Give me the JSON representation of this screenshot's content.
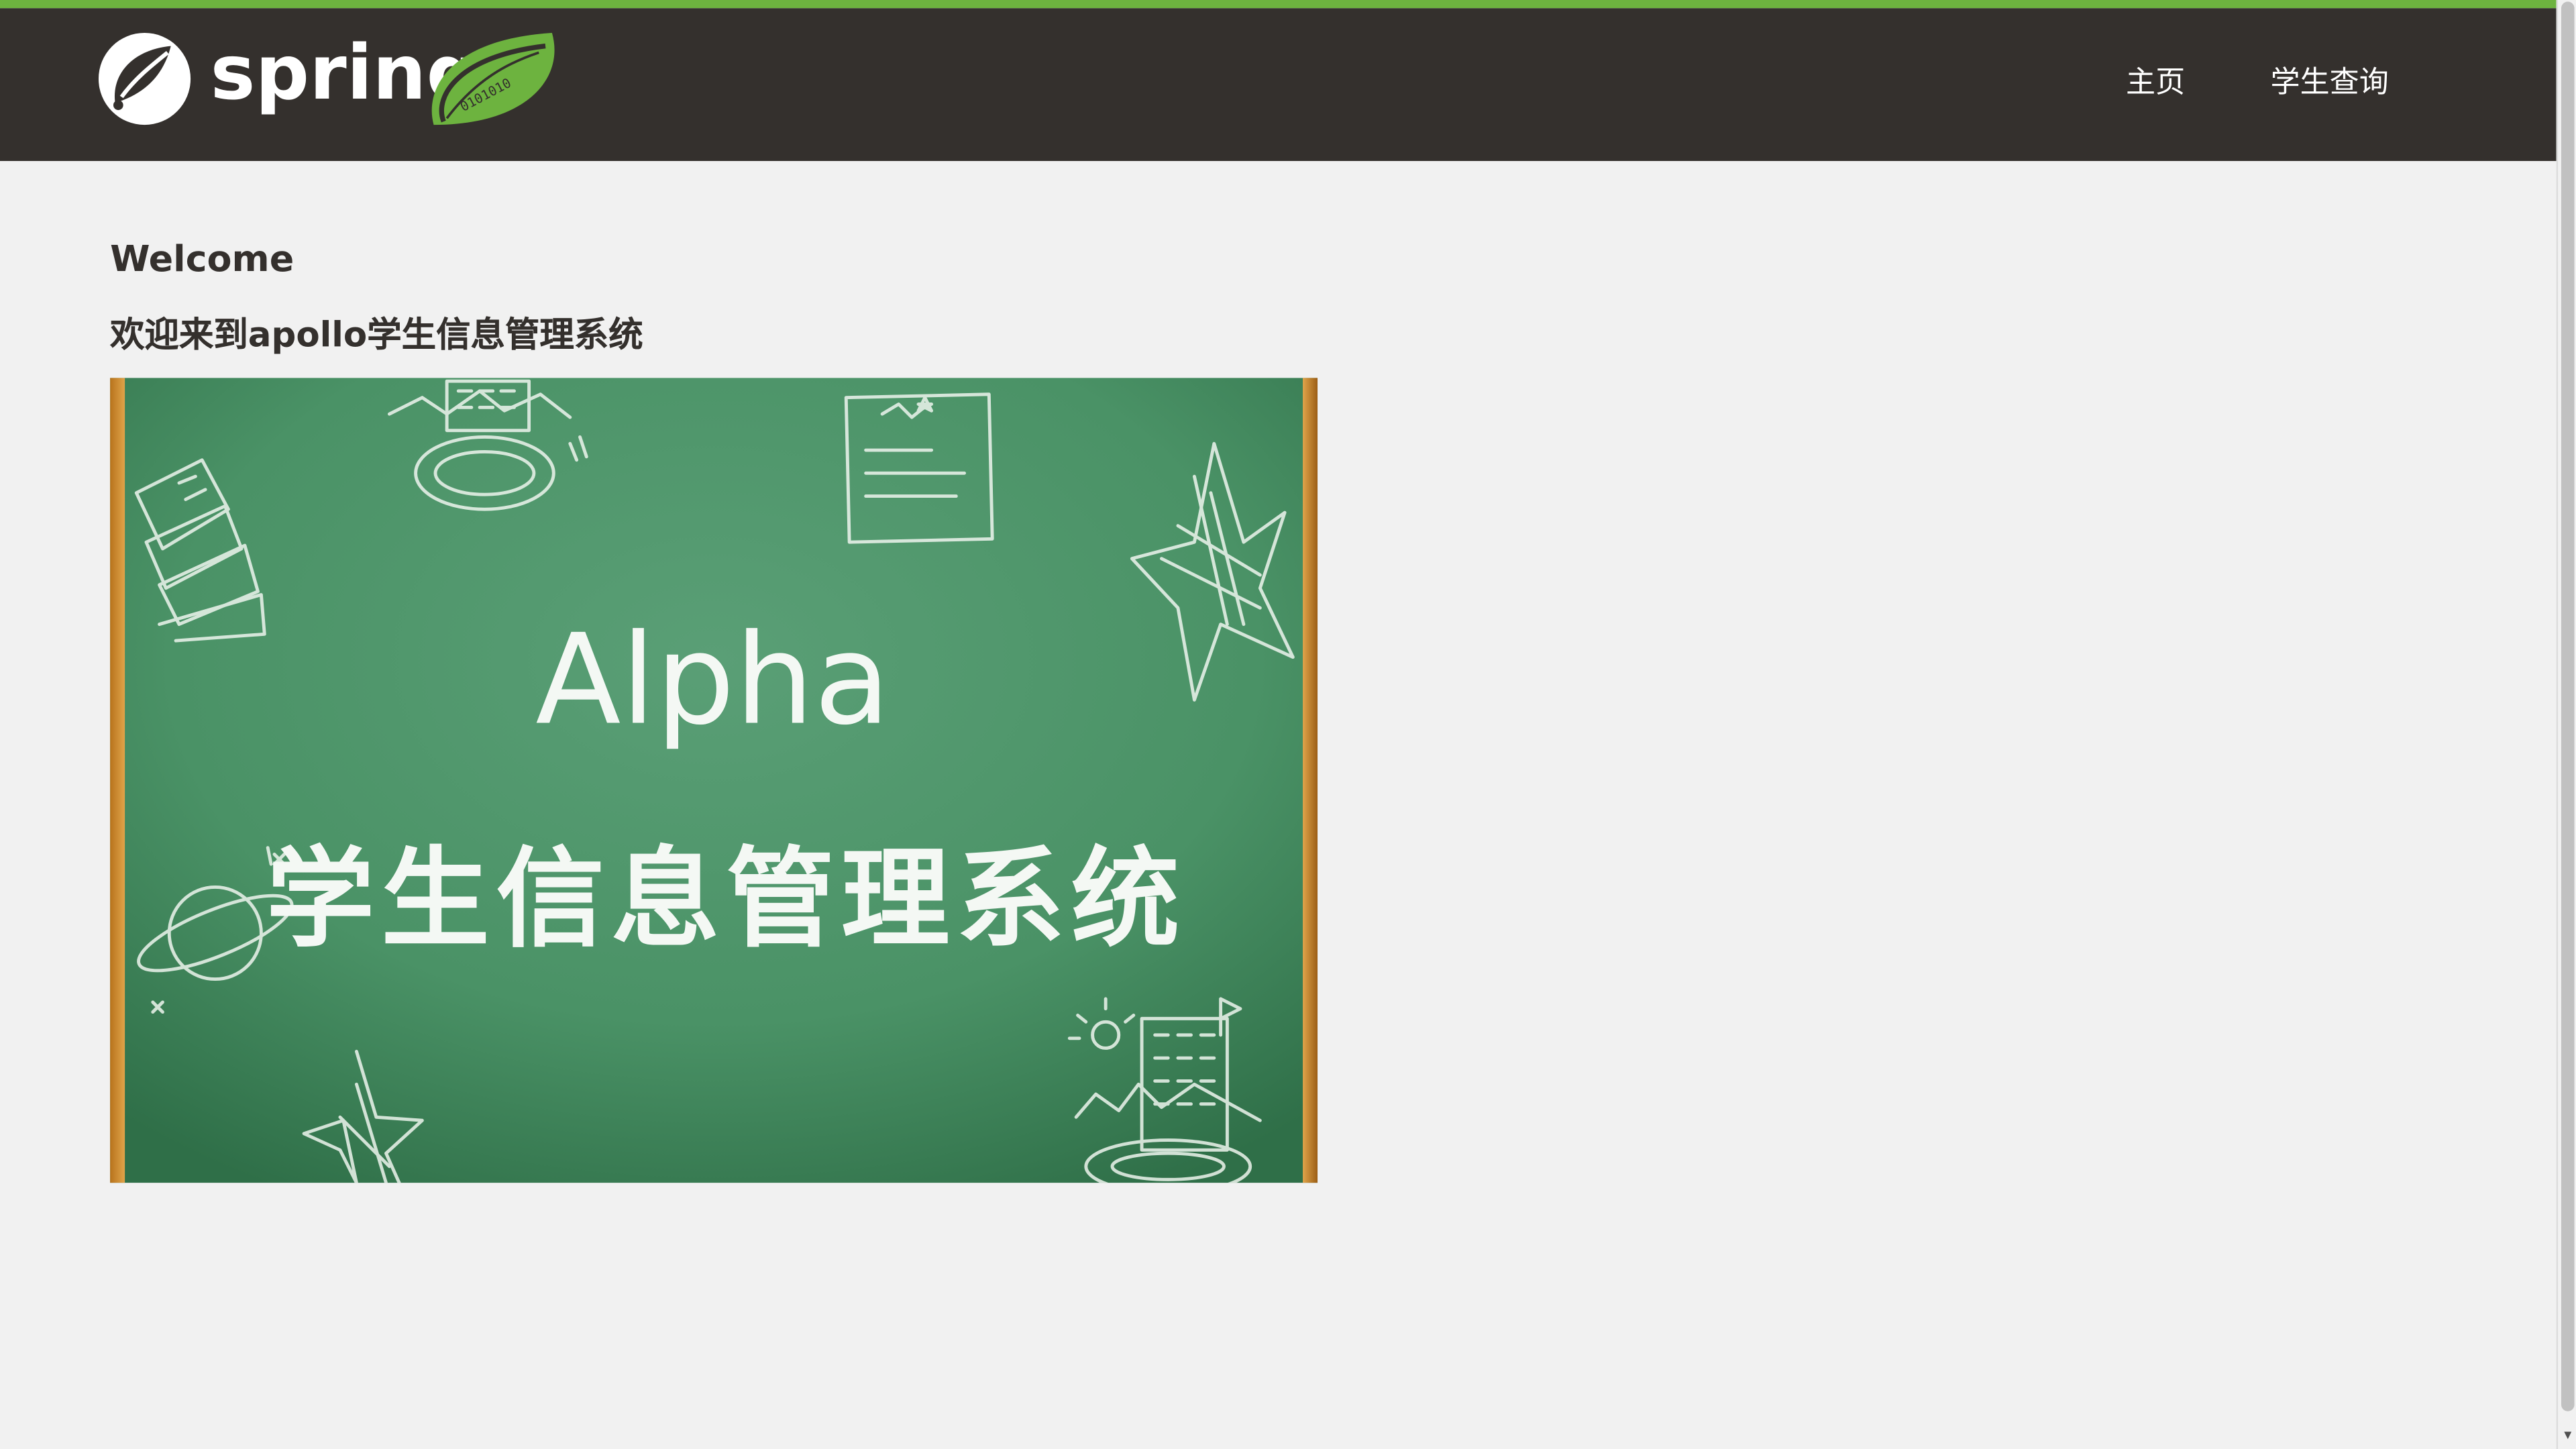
{
  "navbar": {
    "logo_text": "spring",
    "logo_leaf_text": "0101010",
    "links": [
      {
        "label": "主页"
      },
      {
        "label": "学生查询"
      }
    ]
  },
  "main": {
    "heading": "Welcome",
    "subheading": "欢迎来到apollo学生信息管理系统",
    "banner": {
      "title": "Alpha",
      "subtitle": "学生信息管理系统"
    }
  },
  "colors": {
    "brand_green": "#6db33f",
    "navbar": "#34302d",
    "page_background": "#f1f1f1",
    "board_green": "#4a9266",
    "board_frame": "#c98a2c"
  },
  "icons": {
    "logo": "spring-logo-icon",
    "scroll_down": "chevron-down-icon"
  }
}
